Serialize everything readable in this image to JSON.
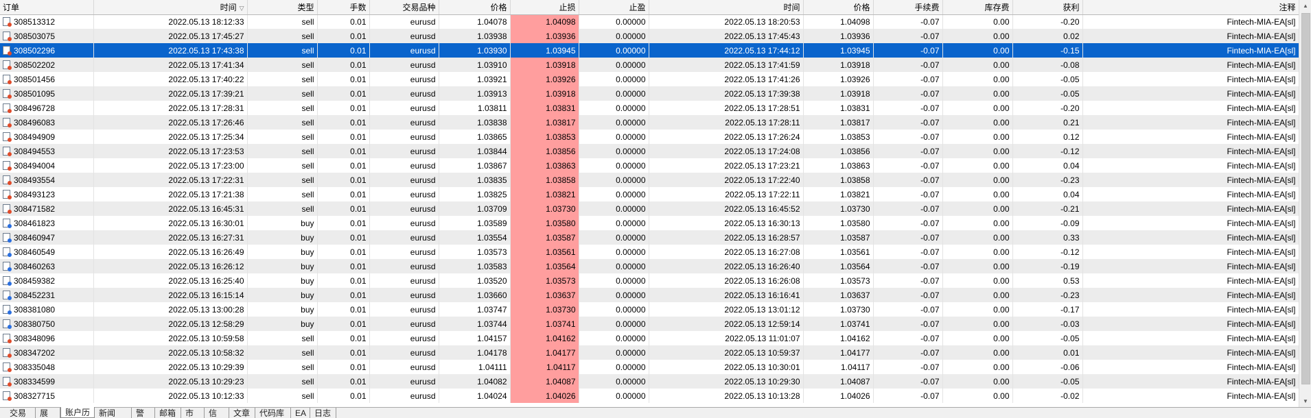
{
  "columns": [
    "订单",
    "时间",
    "类型",
    "手数",
    "交易品种",
    "价格",
    "止损",
    "止盈",
    "时间",
    "价格",
    "手续费",
    "库存费",
    "获利",
    "注释"
  ],
  "rows": [
    {
      "order": "308513312",
      "open_time": "2022.05.13 18:12:33",
      "type": "sell",
      "lots": "0.01",
      "symbol": "eurusd",
      "open_price": "1.04078",
      "sl": "1.04098",
      "tp": "0.00000",
      "close_time": "2022.05.13 18:20:53",
      "close_price": "1.04098",
      "commission": "-0.07",
      "swap": "0.00",
      "profit": "-0.20",
      "comment": "Fintech-MIA-EA[sl]"
    },
    {
      "order": "308503075",
      "open_time": "2022.05.13 17:45:27",
      "type": "sell",
      "lots": "0.01",
      "symbol": "eurusd",
      "open_price": "1.03938",
      "sl": "1.03936",
      "tp": "0.00000",
      "close_time": "2022.05.13 17:45:43",
      "close_price": "1.03936",
      "commission": "-0.07",
      "swap": "0.00",
      "profit": "0.02",
      "comment": "Fintech-MIA-EA[sl]"
    },
    {
      "order": "308502296",
      "open_time": "2022.05.13 17:43:38",
      "type": "sell",
      "lots": "0.01",
      "symbol": "eurusd",
      "open_price": "1.03930",
      "sl": "1.03945",
      "tp": "0.00000",
      "close_time": "2022.05.13 17:44:12",
      "close_price": "1.03945",
      "commission": "-0.07",
      "swap": "0.00",
      "profit": "-0.15",
      "comment": "Fintech-MIA-EA[sl]"
    },
    {
      "order": "308502202",
      "open_time": "2022.05.13 17:41:34",
      "type": "sell",
      "lots": "0.01",
      "symbol": "eurusd",
      "open_price": "1.03910",
      "sl": "1.03918",
      "tp": "0.00000",
      "close_time": "2022.05.13 17:41:59",
      "close_price": "1.03918",
      "commission": "-0.07",
      "swap": "0.00",
      "profit": "-0.08",
      "comment": "Fintech-MIA-EA[sl]"
    },
    {
      "order": "308501456",
      "open_time": "2022.05.13 17:40:22",
      "type": "sell",
      "lots": "0.01",
      "symbol": "eurusd",
      "open_price": "1.03921",
      "sl": "1.03926",
      "tp": "0.00000",
      "close_time": "2022.05.13 17:41:26",
      "close_price": "1.03926",
      "commission": "-0.07",
      "swap": "0.00",
      "profit": "-0.05",
      "comment": "Fintech-MIA-EA[sl]"
    },
    {
      "order": "308501095",
      "open_time": "2022.05.13 17:39:21",
      "type": "sell",
      "lots": "0.01",
      "symbol": "eurusd",
      "open_price": "1.03913",
      "sl": "1.03918",
      "tp": "0.00000",
      "close_time": "2022.05.13 17:39:38",
      "close_price": "1.03918",
      "commission": "-0.07",
      "swap": "0.00",
      "profit": "-0.05",
      "comment": "Fintech-MIA-EA[sl]"
    },
    {
      "order": "308496728",
      "open_time": "2022.05.13 17:28:31",
      "type": "sell",
      "lots": "0.01",
      "symbol": "eurusd",
      "open_price": "1.03811",
      "sl": "1.03831",
      "tp": "0.00000",
      "close_time": "2022.05.13 17:28:51",
      "close_price": "1.03831",
      "commission": "-0.07",
      "swap": "0.00",
      "profit": "-0.20",
      "comment": "Fintech-MIA-EA[sl]"
    },
    {
      "order": "308496083",
      "open_time": "2022.05.13 17:26:46",
      "type": "sell",
      "lots": "0.01",
      "symbol": "eurusd",
      "open_price": "1.03838",
      "sl": "1.03817",
      "tp": "0.00000",
      "close_time": "2022.05.13 17:28:11",
      "close_price": "1.03817",
      "commission": "-0.07",
      "swap": "0.00",
      "profit": "0.21",
      "comment": "Fintech-MIA-EA[sl]"
    },
    {
      "order": "308494909",
      "open_time": "2022.05.13 17:25:34",
      "type": "sell",
      "lots": "0.01",
      "symbol": "eurusd",
      "open_price": "1.03865",
      "sl": "1.03853",
      "tp": "0.00000",
      "close_time": "2022.05.13 17:26:24",
      "close_price": "1.03853",
      "commission": "-0.07",
      "swap": "0.00",
      "profit": "0.12",
      "comment": "Fintech-MIA-EA[sl]"
    },
    {
      "order": "308494553",
      "open_time": "2022.05.13 17:23:53",
      "type": "sell",
      "lots": "0.01",
      "symbol": "eurusd",
      "open_price": "1.03844",
      "sl": "1.03856",
      "tp": "0.00000",
      "close_time": "2022.05.13 17:24:08",
      "close_price": "1.03856",
      "commission": "-0.07",
      "swap": "0.00",
      "profit": "-0.12",
      "comment": "Fintech-MIA-EA[sl]"
    },
    {
      "order": "308494004",
      "open_time": "2022.05.13 17:23:00",
      "type": "sell",
      "lots": "0.01",
      "symbol": "eurusd",
      "open_price": "1.03867",
      "sl": "1.03863",
      "tp": "0.00000",
      "close_time": "2022.05.13 17:23:21",
      "close_price": "1.03863",
      "commission": "-0.07",
      "swap": "0.00",
      "profit": "0.04",
      "comment": "Fintech-MIA-EA[sl]"
    },
    {
      "order": "308493554",
      "open_time": "2022.05.13 17:22:31",
      "type": "sell",
      "lots": "0.01",
      "symbol": "eurusd",
      "open_price": "1.03835",
      "sl": "1.03858",
      "tp": "0.00000",
      "close_time": "2022.05.13 17:22:40",
      "close_price": "1.03858",
      "commission": "-0.07",
      "swap": "0.00",
      "profit": "-0.23",
      "comment": "Fintech-MIA-EA[sl]"
    },
    {
      "order": "308493123",
      "open_time": "2022.05.13 17:21:38",
      "type": "sell",
      "lots": "0.01",
      "symbol": "eurusd",
      "open_price": "1.03825",
      "sl": "1.03821",
      "tp": "0.00000",
      "close_time": "2022.05.13 17:22:11",
      "close_price": "1.03821",
      "commission": "-0.07",
      "swap": "0.00",
      "profit": "0.04",
      "comment": "Fintech-MIA-EA[sl]"
    },
    {
      "order": "308471582",
      "open_time": "2022.05.13 16:45:31",
      "type": "sell",
      "lots": "0.01",
      "symbol": "eurusd",
      "open_price": "1.03709",
      "sl": "1.03730",
      "tp": "0.00000",
      "close_time": "2022.05.13 16:45:52",
      "close_price": "1.03730",
      "commission": "-0.07",
      "swap": "0.00",
      "profit": "-0.21",
      "comment": "Fintech-MIA-EA[sl]"
    },
    {
      "order": "308461823",
      "open_time": "2022.05.13 16:30:01",
      "type": "buy",
      "lots": "0.01",
      "symbol": "eurusd",
      "open_price": "1.03589",
      "sl": "1.03580",
      "tp": "0.00000",
      "close_time": "2022.05.13 16:30:13",
      "close_price": "1.03580",
      "commission": "-0.07",
      "swap": "0.00",
      "profit": "-0.09",
      "comment": "Fintech-MIA-EA[sl]"
    },
    {
      "order": "308460947",
      "open_time": "2022.05.13 16:27:31",
      "type": "buy",
      "lots": "0.01",
      "symbol": "eurusd",
      "open_price": "1.03554",
      "sl": "1.03587",
      "tp": "0.00000",
      "close_time": "2022.05.13 16:28:57",
      "close_price": "1.03587",
      "commission": "-0.07",
      "swap": "0.00",
      "profit": "0.33",
      "comment": "Fintech-MIA-EA[sl]"
    },
    {
      "order": "308460549",
      "open_time": "2022.05.13 16:26:49",
      "type": "buy",
      "lots": "0.01",
      "symbol": "eurusd",
      "open_price": "1.03573",
      "sl": "1.03561",
      "tp": "0.00000",
      "close_time": "2022.05.13 16:27:08",
      "close_price": "1.03561",
      "commission": "-0.07",
      "swap": "0.00",
      "profit": "-0.12",
      "comment": "Fintech-MIA-EA[sl]"
    },
    {
      "order": "308460263",
      "open_time": "2022.05.13 16:26:12",
      "type": "buy",
      "lots": "0.01",
      "symbol": "eurusd",
      "open_price": "1.03583",
      "sl": "1.03564",
      "tp": "0.00000",
      "close_time": "2022.05.13 16:26:40",
      "close_price": "1.03564",
      "commission": "-0.07",
      "swap": "0.00",
      "profit": "-0.19",
      "comment": "Fintech-MIA-EA[sl]"
    },
    {
      "order": "308459382",
      "open_time": "2022.05.13 16:25:40",
      "type": "buy",
      "lots": "0.01",
      "symbol": "eurusd",
      "open_price": "1.03520",
      "sl": "1.03573",
      "tp": "0.00000",
      "close_time": "2022.05.13 16:26:08",
      "close_price": "1.03573",
      "commission": "-0.07",
      "swap": "0.00",
      "profit": "0.53",
      "comment": "Fintech-MIA-EA[sl]"
    },
    {
      "order": "308452231",
      "open_time": "2022.05.13 16:15:14",
      "type": "buy",
      "lots": "0.01",
      "symbol": "eurusd",
      "open_price": "1.03660",
      "sl": "1.03637",
      "tp": "0.00000",
      "close_time": "2022.05.13 16:16:41",
      "close_price": "1.03637",
      "commission": "-0.07",
      "swap": "0.00",
      "profit": "-0.23",
      "comment": "Fintech-MIA-EA[sl]"
    },
    {
      "order": "308381080",
      "open_time": "2022.05.13 13:00:28",
      "type": "buy",
      "lots": "0.01",
      "symbol": "eurusd",
      "open_price": "1.03747",
      "sl": "1.03730",
      "tp": "0.00000",
      "close_time": "2022.05.13 13:01:12",
      "close_price": "1.03730",
      "commission": "-0.07",
      "swap": "0.00",
      "profit": "-0.17",
      "comment": "Fintech-MIA-EA[sl]"
    },
    {
      "order": "308380750",
      "open_time": "2022.05.13 12:58:29",
      "type": "buy",
      "lots": "0.01",
      "symbol": "eurusd",
      "open_price": "1.03744",
      "sl": "1.03741",
      "tp": "0.00000",
      "close_time": "2022.05.13 12:59:14",
      "close_price": "1.03741",
      "commission": "-0.07",
      "swap": "0.00",
      "profit": "-0.03",
      "comment": "Fintech-MIA-EA[sl]"
    },
    {
      "order": "308348096",
      "open_time": "2022.05.13 10:59:58",
      "type": "sell",
      "lots": "0.01",
      "symbol": "eurusd",
      "open_price": "1.04157",
      "sl": "1.04162",
      "tp": "0.00000",
      "close_time": "2022.05.13 11:01:07",
      "close_price": "1.04162",
      "commission": "-0.07",
      "swap": "0.00",
      "profit": "-0.05",
      "comment": "Fintech-MIA-EA[sl]"
    },
    {
      "order": "308347202",
      "open_time": "2022.05.13 10:58:32",
      "type": "sell",
      "lots": "0.01",
      "symbol": "eurusd",
      "open_price": "1.04178",
      "sl": "1.04177",
      "tp": "0.00000",
      "close_time": "2022.05.13 10:59:37",
      "close_price": "1.04177",
      "commission": "-0.07",
      "swap": "0.00",
      "profit": "0.01",
      "comment": "Fintech-MIA-EA[sl]"
    },
    {
      "order": "308335048",
      "open_time": "2022.05.13 10:29:39",
      "type": "sell",
      "lots": "0.01",
      "symbol": "eurusd",
      "open_price": "1.04111",
      "sl": "1.04117",
      "tp": "0.00000",
      "close_time": "2022.05.13 10:30:01",
      "close_price": "1.04117",
      "commission": "-0.07",
      "swap": "0.00",
      "profit": "-0.06",
      "comment": "Fintech-MIA-EA[sl]"
    },
    {
      "order": "308334599",
      "open_time": "2022.05.13 10:29:23",
      "type": "sell",
      "lots": "0.01",
      "symbol": "eurusd",
      "open_price": "1.04082",
      "sl": "1.04087",
      "tp": "0.00000",
      "close_time": "2022.05.13 10:29:30",
      "close_price": "1.04087",
      "commission": "-0.07",
      "swap": "0.00",
      "profit": "-0.05",
      "comment": "Fintech-MIA-EA[sl]"
    },
    {
      "order": "308327715",
      "open_time": "2022.05.13 10:12:33",
      "type": "sell",
      "lots": "0.01",
      "symbol": "eurusd",
      "open_price": "1.04024",
      "sl": "1.04026",
      "tp": "0.00000",
      "close_time": "2022.05.13 10:13:28",
      "close_price": "1.04026",
      "commission": "-0.07",
      "swap": "0.00",
      "profit": "-0.02",
      "comment": "Fintech-MIA-EA[sl]"
    }
  ],
  "selected_order": "308502296",
  "sorted_column": "时间",
  "tabs": [
    "交易",
    "展示",
    "账户历史",
    "新闻",
    "警报",
    "邮箱",
    "市场",
    "信号",
    "文章",
    "代码库",
    "EA",
    "日志"
  ],
  "active_tab": "账户历史",
  "colors": {
    "selection": "#0a64cc",
    "stop_loss_cell": "#ff9e9e",
    "alt_row": "#ececec"
  },
  "icons": {
    "sell_row": "sell-order-icon",
    "buy_row": "buy-order-icon",
    "sort": "sort-descending-icon"
  }
}
